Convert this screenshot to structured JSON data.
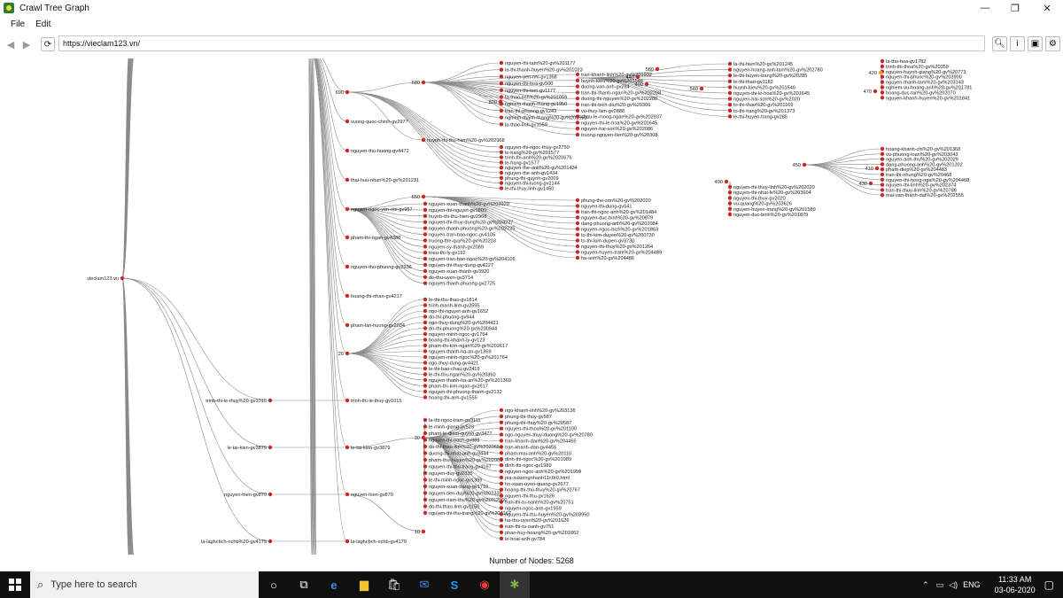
{
  "window": {
    "title": "Crawl Tree Graph",
    "minimize": "—",
    "restore": "❐",
    "close": "✕"
  },
  "menu": {
    "file": "File",
    "edit": "Edit"
  },
  "nav": {
    "url": "https://vieclam123.vn/",
    "back_icon": "chevron-left-icon",
    "forward_icon": "chevron-right-icon",
    "reload_icon": "reload-icon",
    "tools": [
      "search-icon",
      "info-icon",
      "save-icon",
      "settings-icon"
    ]
  },
  "status": {
    "node_count": "Number of Nodes: 5268"
  },
  "taskbar": {
    "search_placeholder": "Type here to search",
    "language": "ENG",
    "time": "11:33 AM",
    "date": "03-06-2020"
  },
  "tree": {
    "root": "vieclam123.vn",
    "lvl1": [
      "trinh-thi-le-thuy%20-gv1015",
      "le-tai-kien-gv3879",
      "nguyen-hien-gv870",
      "la-laghcbch-nchb%20-gv4179"
    ],
    "lvl2_numbers": [
      "690",
      "20"
    ],
    "lvl2": [
      "vuong-quoc-chinh-gv2977",
      "nguyen-thu-huong-gv4472",
      "thai-huu-nhan%20-gv%201231",
      "nguyen-ngoc-yen-nhi-gv957",
      "pham-thi-ngan-gv4380",
      "nguyen-thu-phuong-gv2936",
      "hoang-thi-nhan-gv4217",
      "pham-lan-huong-gv2034",
      "trinh-thi-le-thuy-gv1015",
      "le-tai-kien-gv3879",
      "nguyen-hien-gv870",
      "la-laghcbch-nchb-gv4179"
    ],
    "lvl3_numbers": [
      "680",
      "820",
      "650",
      "30",
      "10"
    ],
    "list_a": [
      "nguyen-thi-tam%20-gv%201177",
      "la-thi-thanh-huyen%20-gv%201023",
      "nguyen-yen-nhi-gv1358",
      "nguyen-thi-hoa-gv500",
      "nguyen-thi-tam-gv1177",
      "la-thao-linh%20-gv%201059",
      "nghiem-thanh-thang-gv1950",
      "tran-thi-phuong-gv1249",
      "nghiem-thanh-thang%20-gv%201950",
      "la-thao-linh-gv1059"
    ],
    "list_b": [
      "huynh-thi-thu-hien%20-gv%202968",
      "nguyen-thi-ngoc-thuy-gv2750",
      "le-hang%20-gv%201577",
      "trinh-thi-anh%20-gv%2020676",
      "le-hang-gv1577",
      "nguyen-the-anh%20-gv%201434",
      "nguyen-the-anh-gv1434",
      "phung-thi-quynh-gv2009",
      "nguyen-thi-luong-gv2144",
      "le-thi-thuy-linh-gv1450"
    ],
    "list_c": [
      "nguyen-xuan-thanh%20-gv%203920",
      "nguyen-thi-nguyet-gv1809",
      "huynh-thi-thu-hien-gv2968",
      "nguyen-thi-thuy-dung%20-gv%204227",
      "nguyen-thanh-phuong%20-gv%202725",
      "nguyen-tran-bao-ngoc-gv4105",
      "truong-the-quy%20-gv%20203",
      "nguyen-sy-thanh-gv2089",
      "trieu-thi-ly-gv192",
      "nguyen-tran-bao-ngoc%20-gv%204105",
      "nguyen-thi-thuy-dung-gv4227",
      "nguyen-xuan-thanh-gv3920",
      "do-thu-uyen-gv3714",
      "nguyen-thanh-phuong-gv2725"
    ],
    "list_d": [
      "le-thi-thu-thao-gv1814",
      "trinh-manh-linh-gv2595",
      "ngo-thi-nguyet-anh-gv1652",
      "do-thi-phuong-gv944",
      "ngo-thuy-dung%20-gv%204421",
      "do-thi-phuong%20-gv%200944",
      "nguyen-minh-ngoc-gv1764",
      "hoang-thi-khanh-ly-gv123",
      "pham-thi-kim-ngan%20-gv%202617",
      "nguyen-thanh-ha-an-gv1369",
      "nguyen-minh-ngoc%20-gv%201764",
      "ngo-thuy-dung-gv4421",
      "le-thi-bao-chau-gv2419",
      "le-thi-thu-ngan%20-gv%20360",
      "nguyen-thanh-ha-an%20-gv%201369",
      "pham-thi-kim-ngan-gv2617",
      "nguyen-thi-phuong-thanh-gv2132",
      "hoang-thi-anh-gv1555"
    ],
    "list_e": [
      "la-thi-ngoc-tram-gv3111",
      "le-minh-giang-gv523",
      "pham-le-diem-quynh-gv3477",
      "nguyen-thi-oanh-gv888",
      "do-thi-thao-linh%20-gv%202055",
      "duong-thi-nhat-anh-gv3444",
      "pham-thu-huyen%20-gv%202060",
      "nguyen-thi-thu-trang-gv4167",
      "nguyen-duy-gv2335",
      "le-thi-minh-ngoc-gv1399",
      "nguyen-xuan-trang-gv1710",
      "nguyen-tien-duy%20-gv%202335",
      "nguyen-nam-thu%20-gv%20%2060",
      "do-thi-thao-linh-gv1150",
      "nguyen-thi-thu-trang%20-gv%204167"
    ],
    "list_f": [
      "ngo-khanh-linh%20-gv%203136",
      "phung-thi-thuy-gv587",
      "phung-thi-thuy%20-gv%20587",
      "nguyen-thi-thoa%20-gv%201100",
      "ngo-nguyen-thuy-duong%20-gv%20780",
      "tran-khanh-dan%20-gv%204455",
      "tran-khanh-dan-gv4455",
      "pham-mai-anh%20-gv%20110",
      "dinh-thi-ngoc%20-gv%201989",
      "dinh-thi-ngoc-gv1989",
      "nguyen-ngoc-anh%20-gv%201959",
      "pia-sukiengnhanh11c0r0.html",
      "ho-xuan-uyen-quang-gv2677",
      "hoang-thi-thu-thuy%20-gv%20767",
      "nguyen-thi-thu-gv1626",
      "tran-thi-tu-oanh%20-gv%20751",
      "nguyen-ngoc-anh-gv1959",
      "nguyen-thi-thu-huyen%20-gv%203950",
      "ha-thu-uyen%20-gv%201626",
      "tran-thi-tu-oanh-gv751",
      "phan-huy-hoang%20-gv%201862",
      "le-hoai-anh-gv784"
    ],
    "list_g": [
      "tran-khanh-linh%20-gv%201932",
      "huynh-kieu%20-gv%201546",
      "duong-van-anh-gv284",
      "tran-thi-thanh-ngan%20-gv%202208",
      "duong-thi-nguyen%20-gv%202288",
      "tran-thi-bich-diu%20-gv%20306",
      "vu-thuy-lien-gv2888",
      "chau-le-mong-ngan%20-gv%202937",
      "nguyen-thi-le-hoa%20-gv%201645",
      "nguyen-hai-son%20-gv%202086",
      "truong-nguyen-tien%20-gv%20308"
    ],
    "list_h": [
      "la-thi-hien%20-gv%201245",
      "nguyen-hoang-anh-tam%20-gv%202780",
      "le-thi-huyen-trang%20-gv%20285",
      "le-thi-thao-gv1183",
      "huynh-kieu%20-gv%201546",
      "nguyen-thi-le-hoa%20-gv%201645",
      "nguyen-hai-son%20-gv%2020",
      "to-thi-thao%20-gv%201169",
      "to-thi-hang%20-gv%201373",
      "le-thi-huyen-trang-gv285"
    ],
    "list_i": [
      "phung-the-son%20-gv%202020",
      "nguyen-thi-dung-gv541",
      "tran-thi-ngoc-anh%20-gv%201484",
      "nguyen-duc-binh%20-gv%20879",
      "dang-phuong-anh%20-gv%202084",
      "nguyen-ngoc-bich%20-gv%201863",
      "to-thi-kim-duyen%20-gv%200730",
      "to-thi-kim-duyen-gv3730",
      "nguyen-thi-thuy%20-gv%201264",
      "nguyen-huyen-tram%20-gv%204489",
      "ha-anh%20-gv%204486"
    ],
    "list_j": [
      "nguyen-thi-thuy-linh%20-gv%202020",
      "nguyen-thi-nhat-le%20-gv%203604",
      "nguyen-thi-thuy-gv2020",
      "vu-quang%20-gv%203626",
      "nguyen-huyen-trang%20-gv%201589",
      "nguyen-duc-binh%20-gv%201879"
    ],
    "list_k": [
      "hoang-khanh-chi%20-gv%201368",
      "vu-phuong-loan%20-gv%203043",
      "nguyen-anh-thu%20-gv%202029",
      "dang-phuong-anh%20-gv%201202",
      "pham-diep%20-gv%204483",
      "tran-thi-nhung%20-gv%20468",
      "nguyen-thi-hong-nga%20-gv%204468",
      "nguyen-thi-linh%20-gv%202374",
      "tran-thi-thuy-linh%20-gv%20786",
      "mai-van-thanh-dat%20-gv%202555"
    ],
    "list_l": [
      "la-thu-hoa-gv1782",
      "trinh-thi-thoa%20-gv%20359",
      "nguyen-huynh-giang%20-gv%20773",
      "nguyen-thi-phuoc%20-gv%203900",
      "nguyen-thanh-tam%20-gv%203143",
      "nghiem-vu-hoang-anh%20-gv%201781",
      "hoang-duc-tan%20-gv%202070",
      "nguyen-khanh-huyen%20-gv%201841"
    ],
    "mid_numbers": [
      "440",
      "560",
      "580",
      "490",
      "450",
      "410",
      "430",
      "420",
      "400",
      "470"
    ]
  }
}
